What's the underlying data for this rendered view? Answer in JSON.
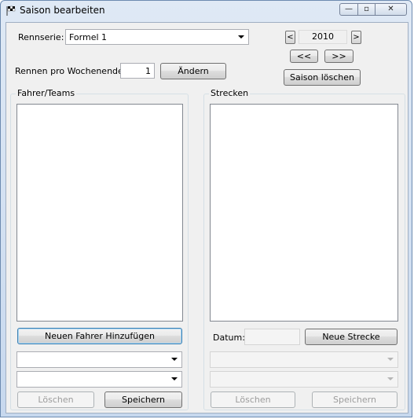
{
  "window": {
    "title": "Saison bearbeiten",
    "icon": "checkered-flag-icon"
  },
  "titlebar_buttons": {
    "minimize": "—",
    "maximize": "▫",
    "close": "✕"
  },
  "series": {
    "label": "Rennserie:",
    "selected": "Formel 1"
  },
  "year": {
    "prev_label": "<",
    "value": "2010",
    "next_label": ">",
    "jump_back_label": "<<",
    "jump_forward_label": ">>"
  },
  "delete_season_label": "Saison löschen",
  "races_per_weekend": {
    "label": "Rennen pro Wochenende:",
    "value": "1",
    "change_label": "Ändern"
  },
  "drivers": {
    "group_title": "Fahrer/Teams",
    "add_label": "Neuen Fahrer Hinzufügen",
    "combo1": "",
    "combo2": "",
    "delete_label": "Löschen",
    "save_label": "Speichern"
  },
  "tracks": {
    "group_title": "Strecken",
    "date_label": "Datum:",
    "date_value": "",
    "new_label": "Neue Strecke",
    "combo1": "",
    "combo2": "",
    "delete_label": "Löschen",
    "save_label": "Speichern"
  }
}
